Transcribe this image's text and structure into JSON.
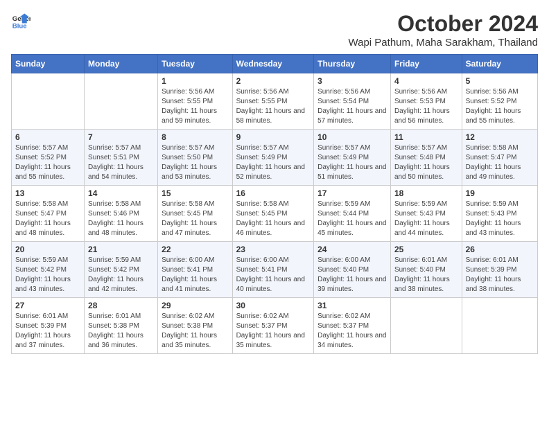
{
  "logo": {
    "general": "General",
    "blue": "Blue"
  },
  "title": "October 2024",
  "subtitle": "Wapi Pathum, Maha Sarakham, Thailand",
  "days_header": [
    "Sunday",
    "Monday",
    "Tuesday",
    "Wednesday",
    "Thursday",
    "Friday",
    "Saturday"
  ],
  "weeks": [
    [
      {
        "day": "",
        "sunrise": "",
        "sunset": "",
        "daylight": ""
      },
      {
        "day": "",
        "sunrise": "",
        "sunset": "",
        "daylight": ""
      },
      {
        "day": "1",
        "sunrise": "Sunrise: 5:56 AM",
        "sunset": "Sunset: 5:55 PM",
        "daylight": "Daylight: 11 hours and 59 minutes."
      },
      {
        "day": "2",
        "sunrise": "Sunrise: 5:56 AM",
        "sunset": "Sunset: 5:55 PM",
        "daylight": "Daylight: 11 hours and 58 minutes."
      },
      {
        "day": "3",
        "sunrise": "Sunrise: 5:56 AM",
        "sunset": "Sunset: 5:54 PM",
        "daylight": "Daylight: 11 hours and 57 minutes."
      },
      {
        "day": "4",
        "sunrise": "Sunrise: 5:56 AM",
        "sunset": "Sunset: 5:53 PM",
        "daylight": "Daylight: 11 hours and 56 minutes."
      },
      {
        "day": "5",
        "sunrise": "Sunrise: 5:56 AM",
        "sunset": "Sunset: 5:52 PM",
        "daylight": "Daylight: 11 hours and 55 minutes."
      }
    ],
    [
      {
        "day": "6",
        "sunrise": "Sunrise: 5:57 AM",
        "sunset": "Sunset: 5:52 PM",
        "daylight": "Daylight: 11 hours and 55 minutes."
      },
      {
        "day": "7",
        "sunrise": "Sunrise: 5:57 AM",
        "sunset": "Sunset: 5:51 PM",
        "daylight": "Daylight: 11 hours and 54 minutes."
      },
      {
        "day": "8",
        "sunrise": "Sunrise: 5:57 AM",
        "sunset": "Sunset: 5:50 PM",
        "daylight": "Daylight: 11 hours and 53 minutes."
      },
      {
        "day": "9",
        "sunrise": "Sunrise: 5:57 AM",
        "sunset": "Sunset: 5:49 PM",
        "daylight": "Daylight: 11 hours and 52 minutes."
      },
      {
        "day": "10",
        "sunrise": "Sunrise: 5:57 AM",
        "sunset": "Sunset: 5:49 PM",
        "daylight": "Daylight: 11 hours and 51 minutes."
      },
      {
        "day": "11",
        "sunrise": "Sunrise: 5:57 AM",
        "sunset": "Sunset: 5:48 PM",
        "daylight": "Daylight: 11 hours and 50 minutes."
      },
      {
        "day": "12",
        "sunrise": "Sunrise: 5:58 AM",
        "sunset": "Sunset: 5:47 PM",
        "daylight": "Daylight: 11 hours and 49 minutes."
      }
    ],
    [
      {
        "day": "13",
        "sunrise": "Sunrise: 5:58 AM",
        "sunset": "Sunset: 5:47 PM",
        "daylight": "Daylight: 11 hours and 48 minutes."
      },
      {
        "day": "14",
        "sunrise": "Sunrise: 5:58 AM",
        "sunset": "Sunset: 5:46 PM",
        "daylight": "Daylight: 11 hours and 48 minutes."
      },
      {
        "day": "15",
        "sunrise": "Sunrise: 5:58 AM",
        "sunset": "Sunset: 5:45 PM",
        "daylight": "Daylight: 11 hours and 47 minutes."
      },
      {
        "day": "16",
        "sunrise": "Sunrise: 5:58 AM",
        "sunset": "Sunset: 5:45 PM",
        "daylight": "Daylight: 11 hours and 46 minutes."
      },
      {
        "day": "17",
        "sunrise": "Sunrise: 5:59 AM",
        "sunset": "Sunset: 5:44 PM",
        "daylight": "Daylight: 11 hours and 45 minutes."
      },
      {
        "day": "18",
        "sunrise": "Sunrise: 5:59 AM",
        "sunset": "Sunset: 5:43 PM",
        "daylight": "Daylight: 11 hours and 44 minutes."
      },
      {
        "day": "19",
        "sunrise": "Sunrise: 5:59 AM",
        "sunset": "Sunset: 5:43 PM",
        "daylight": "Daylight: 11 hours and 43 minutes."
      }
    ],
    [
      {
        "day": "20",
        "sunrise": "Sunrise: 5:59 AM",
        "sunset": "Sunset: 5:42 PM",
        "daylight": "Daylight: 11 hours and 43 minutes."
      },
      {
        "day": "21",
        "sunrise": "Sunrise: 5:59 AM",
        "sunset": "Sunset: 5:42 PM",
        "daylight": "Daylight: 11 hours and 42 minutes."
      },
      {
        "day": "22",
        "sunrise": "Sunrise: 6:00 AM",
        "sunset": "Sunset: 5:41 PM",
        "daylight": "Daylight: 11 hours and 41 minutes."
      },
      {
        "day": "23",
        "sunrise": "Sunrise: 6:00 AM",
        "sunset": "Sunset: 5:41 PM",
        "daylight": "Daylight: 11 hours and 40 minutes."
      },
      {
        "day": "24",
        "sunrise": "Sunrise: 6:00 AM",
        "sunset": "Sunset: 5:40 PM",
        "daylight": "Daylight: 11 hours and 39 minutes."
      },
      {
        "day": "25",
        "sunrise": "Sunrise: 6:01 AM",
        "sunset": "Sunset: 5:40 PM",
        "daylight": "Daylight: 11 hours and 38 minutes."
      },
      {
        "day": "26",
        "sunrise": "Sunrise: 6:01 AM",
        "sunset": "Sunset: 5:39 PM",
        "daylight": "Daylight: 11 hours and 38 minutes."
      }
    ],
    [
      {
        "day": "27",
        "sunrise": "Sunrise: 6:01 AM",
        "sunset": "Sunset: 5:39 PM",
        "daylight": "Daylight: 11 hours and 37 minutes."
      },
      {
        "day": "28",
        "sunrise": "Sunrise: 6:01 AM",
        "sunset": "Sunset: 5:38 PM",
        "daylight": "Daylight: 11 hours and 36 minutes."
      },
      {
        "day": "29",
        "sunrise": "Sunrise: 6:02 AM",
        "sunset": "Sunset: 5:38 PM",
        "daylight": "Daylight: 11 hours and 35 minutes."
      },
      {
        "day": "30",
        "sunrise": "Sunrise: 6:02 AM",
        "sunset": "Sunset: 5:37 PM",
        "daylight": "Daylight: 11 hours and 35 minutes."
      },
      {
        "day": "31",
        "sunrise": "Sunrise: 6:02 AM",
        "sunset": "Sunset: 5:37 PM",
        "daylight": "Daylight: 11 hours and 34 minutes."
      },
      {
        "day": "",
        "sunrise": "",
        "sunset": "",
        "daylight": ""
      },
      {
        "day": "",
        "sunrise": "",
        "sunset": "",
        "daylight": ""
      }
    ]
  ]
}
